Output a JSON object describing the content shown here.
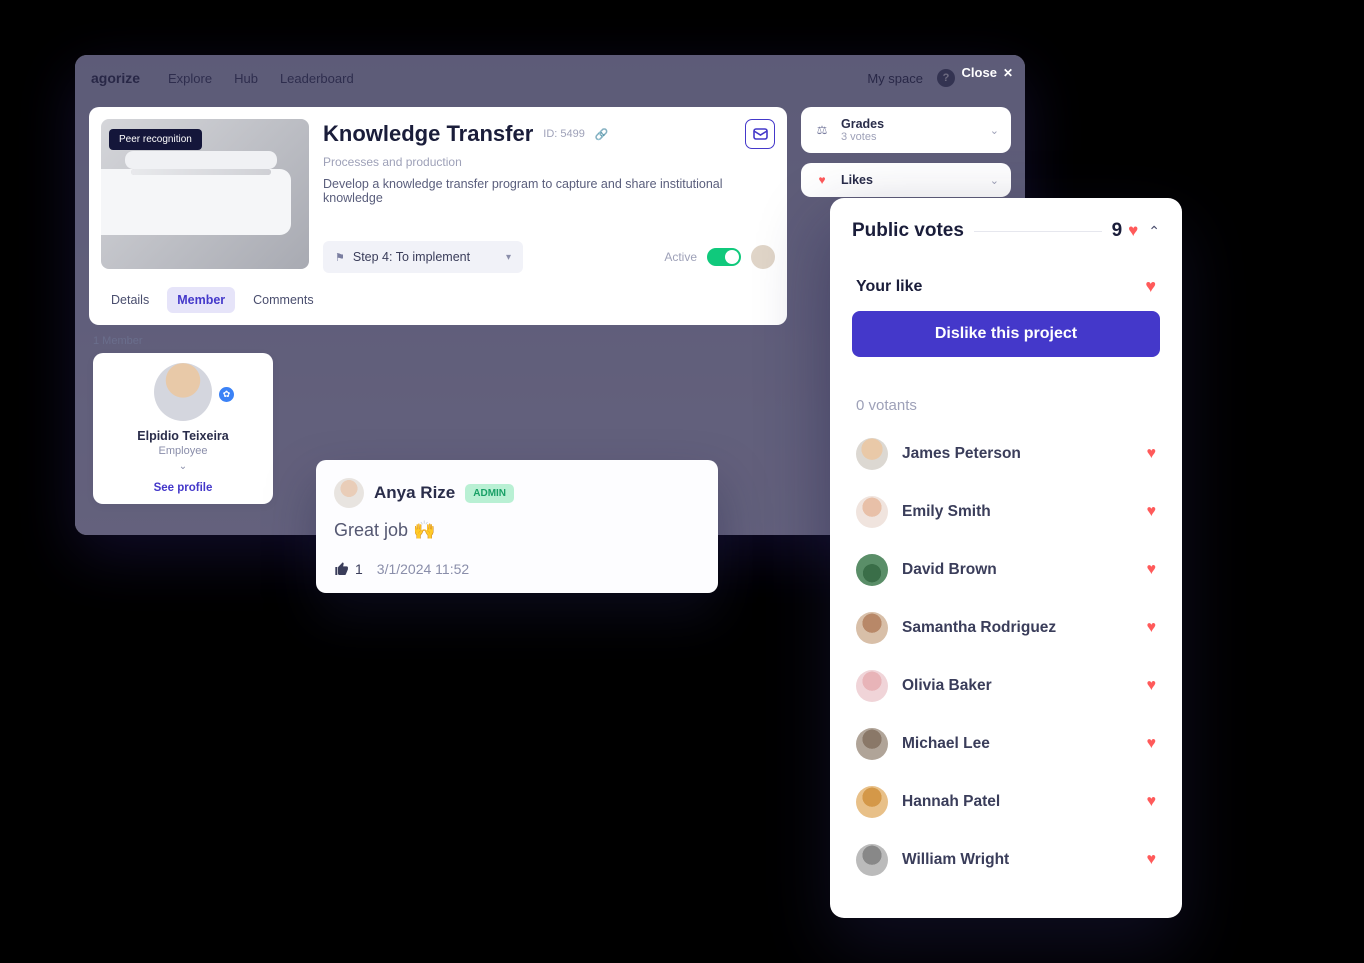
{
  "topbar": {
    "brand": "agorize",
    "nav": [
      "Explore",
      "Hub",
      "Leaderboard"
    ],
    "myspace": "My space",
    "close": "Close"
  },
  "project": {
    "badge": "Peer recognition",
    "title": "Knowledge Transfer",
    "id": "ID: 5499",
    "category": "Processes and production",
    "description": "Develop a knowledge transfer program to capture and share institutional knowledge",
    "step": "Step 4: To implement",
    "active_label": "Active"
  },
  "tabs": [
    "Details",
    "Member",
    "Comments"
  ],
  "side": {
    "grades": {
      "title": "Grades",
      "sub": "3 votes"
    },
    "likes": {
      "title": "Likes"
    }
  },
  "member": {
    "count": "1 Member",
    "name": "Elpidio Teixeira",
    "role": "Employee",
    "link": "See profile"
  },
  "comment": {
    "author": "Anya Rize",
    "badge": "ADMIN",
    "body": "Great job 🙌",
    "likes": "1",
    "timestamp": "3/1/2024 11:52"
  },
  "votes": {
    "title": "Public votes",
    "count": "9",
    "your_like": "Your like",
    "dislike_btn": "Dislike this project",
    "votants": "0 votants",
    "list": [
      "James Peterson",
      "Emily Smith",
      "David Brown",
      "Samantha Rodriguez",
      "Olivia Baker",
      "Michael Lee",
      "Hannah Patel",
      "William Wright"
    ]
  }
}
